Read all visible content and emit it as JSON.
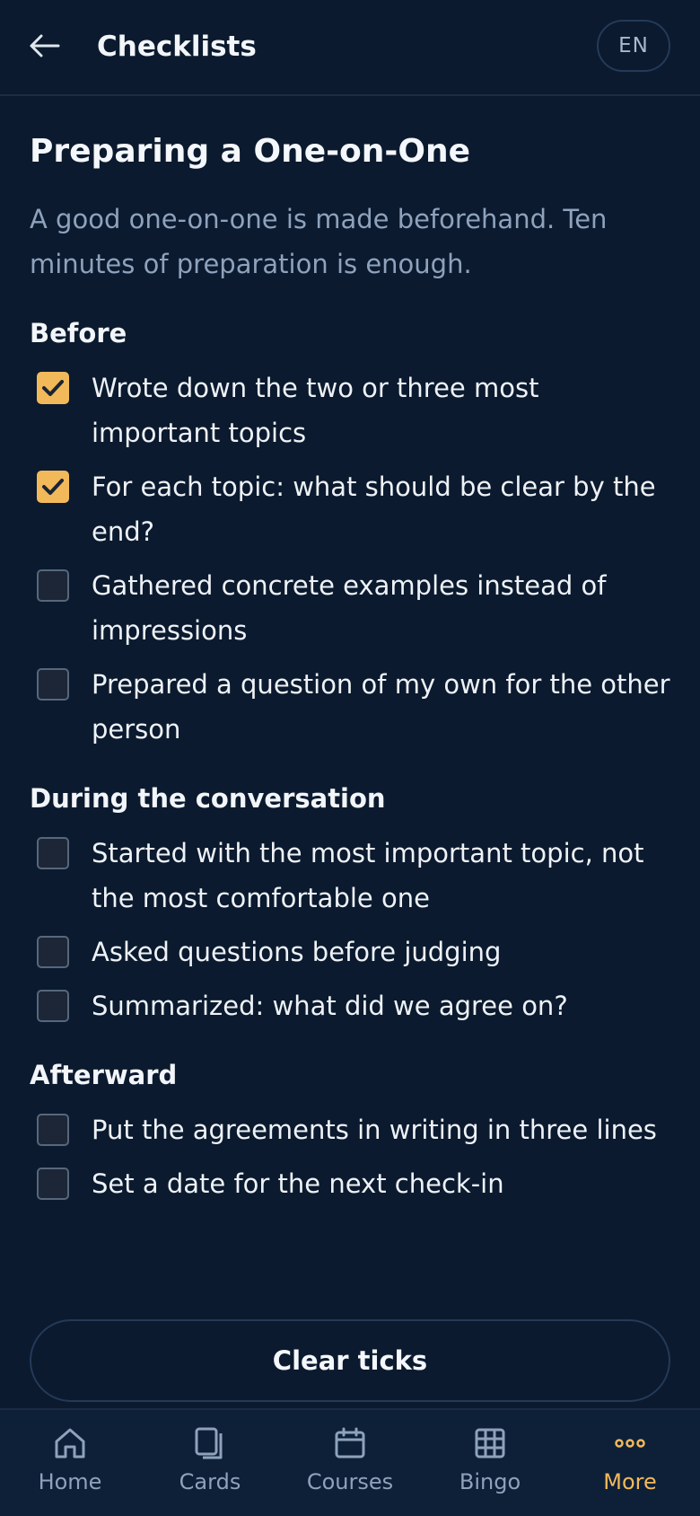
{
  "header": {
    "back_icon": "arrow-left-icon",
    "title": "Checklists",
    "language": "EN"
  },
  "page": {
    "title": "Preparing a One-on-One",
    "intro": "A good one-on-one is made beforehand. Ten minutes of preparation is enough."
  },
  "sections": [
    {
      "title": "Before",
      "items": [
        {
          "text": "Wrote down the two or three most important topics",
          "checked": true
        },
        {
          "text": "For each topic: what should be clear by the end?",
          "checked": true
        },
        {
          "text": "Gathered concrete examples instead of impressions",
          "checked": false
        },
        {
          "text": "Prepared a question of my own for the other person",
          "checked": false
        }
      ]
    },
    {
      "title": "During the conversation",
      "items": [
        {
          "text": "Started with the most important topic, not the most comfortable one",
          "checked": false
        },
        {
          "text": "Asked questions before judging",
          "checked": false
        },
        {
          "text": "Summarized: what did we agree on?",
          "checked": false
        }
      ]
    },
    {
      "title": "Afterward",
      "items": [
        {
          "text": "Put the agreements in writing in three lines",
          "checked": false
        },
        {
          "text": "Set a date for the next check-in",
          "checked": false
        }
      ]
    }
  ],
  "actions": {
    "clear_label": "Clear ticks"
  },
  "nav": {
    "items": [
      {
        "label": "Home",
        "icon": "home-icon",
        "active": false
      },
      {
        "label": "Cards",
        "icon": "cards-icon",
        "active": false
      },
      {
        "label": "Courses",
        "icon": "calendar-icon",
        "active": false
      },
      {
        "label": "Bingo",
        "icon": "grid-icon",
        "active": false
      },
      {
        "label": "More",
        "icon": "more-dots-icon",
        "active": true
      }
    ]
  },
  "colors": {
    "background": "#0b1a2e",
    "accent": "#f2b95a",
    "muted_text": "#8ea2bc"
  }
}
